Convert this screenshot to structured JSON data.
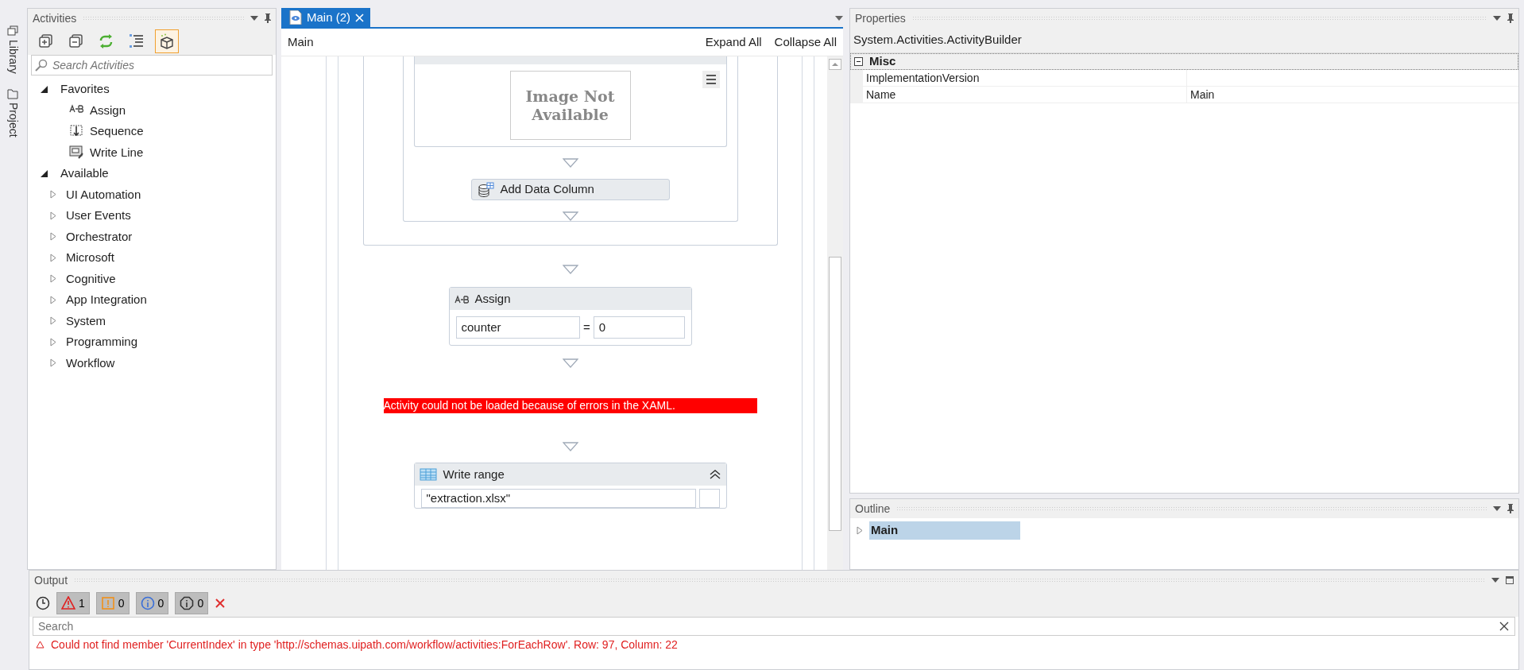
{
  "side_tabs": [
    {
      "label": "Library",
      "kind": "library"
    },
    {
      "label": "Project",
      "kind": "project"
    }
  ],
  "activities": {
    "title": "Activities",
    "toolbar": [
      {
        "kind": "expand",
        "selected": false
      },
      {
        "kind": "collapse",
        "selected": false
      },
      {
        "kind": "refresh",
        "selected": false
      },
      {
        "kind": "list",
        "selected": false
      },
      {
        "kind": "package",
        "selected": true
      }
    ],
    "search": {
      "placeholder": "Search Activities"
    },
    "tree": [
      {
        "label": "Favorites",
        "expanded": true,
        "children": [
          {
            "label": "Assign",
            "kind": "assign"
          },
          {
            "label": "Sequence",
            "kind": "sequence"
          },
          {
            "label": "Write Line",
            "kind": "writeline"
          }
        ]
      },
      {
        "label": "Available",
        "expanded": true,
        "children": [
          {
            "label": "UI Automation",
            "expanded": false
          },
          {
            "label": "User Events",
            "expanded": false
          },
          {
            "label": "Orchestrator",
            "expanded": false
          },
          {
            "label": "Microsoft",
            "expanded": false
          },
          {
            "label": "Cognitive",
            "expanded": false
          },
          {
            "label": "App Integration",
            "expanded": false
          },
          {
            "label": "System",
            "expanded": false
          },
          {
            "label": "Programming",
            "expanded": false
          },
          {
            "label": "Workflow",
            "expanded": false
          }
        ]
      }
    ]
  },
  "document": {
    "tabs": [
      {
        "label": "Main (2)",
        "selected": true
      }
    ],
    "breadcrumb": "Main",
    "actions": [
      "Expand All",
      "Collapse All"
    ],
    "canvas": {
      "image_text": "Image Not Available",
      "add_column": "Add Data Column",
      "assign": {
        "title": "Assign",
        "to": "counter",
        "operator": "=",
        "value": "0"
      },
      "error": "Activity could not be loaded because of errors in the XAML.",
      "write_range": {
        "title": "Write range",
        "field": "\"extraction.xlsx\""
      }
    }
  },
  "properties": {
    "title": "Properties",
    "object": "System.Activities.ActivityBuilder",
    "category": {
      "label": "Misc",
      "expanded": true
    },
    "rows": [
      {
        "name": "ImplementationVersion",
        "value": ""
      },
      {
        "name": "Name",
        "value": "Main"
      }
    ]
  },
  "outline": {
    "title": "Outline",
    "tree": [
      {
        "label": "Main",
        "selected": true,
        "expanded": false
      }
    ]
  },
  "output": {
    "title": "Output",
    "filters": [
      {
        "kind": "error",
        "count": "1"
      },
      {
        "kind": "warning",
        "count": "0"
      },
      {
        "kind": "info",
        "count": "0"
      },
      {
        "kind": "trace",
        "count": "0"
      }
    ],
    "search": {
      "placeholder": "Search"
    },
    "messages": [
      {
        "kind": "error",
        "text": "Could not find member 'CurrentIndex' in type 'http://schemas.uipath.com/workflow/activities:ForEachRow'. Row: 97, Column: 22"
      }
    ]
  }
}
